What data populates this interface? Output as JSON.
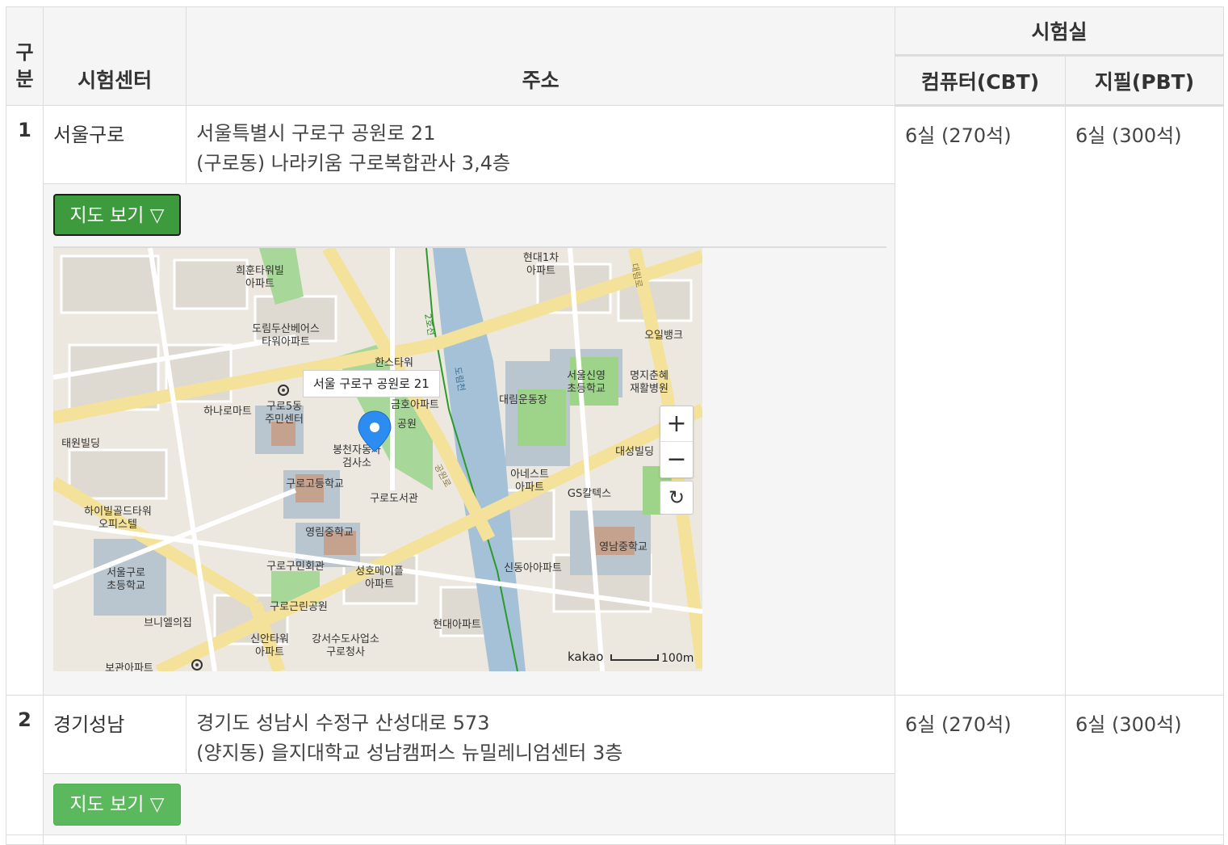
{
  "headers": {
    "gubun": "구분",
    "center": "시험센터",
    "address": "주소",
    "rooms": "시험실",
    "cbt": "컴퓨터(CBT)",
    "pbt": "지필(PBT)"
  },
  "rows": [
    {
      "num": "1",
      "center": "서울구로",
      "address_line1": "서울특별시 구로구 공원로 21",
      "address_line2": "(구로동) 나라키움 구로복합관사 3,4층",
      "cbt": "6실 (270석)",
      "pbt": "6실 (300석)",
      "map_button": "지도 보기 ▽"
    },
    {
      "num": "2",
      "center": "경기성남",
      "address_line1": "경기도 성남시 수정구 산성대로 573",
      "address_line2": "(양지동) 을지대학교 성남캠퍼스 뉴밀레니엄센터 3층",
      "cbt": "6실 (270석)",
      "pbt": "6실 (300석)",
      "map_button": "지도 보기 ▽"
    }
  ],
  "map": {
    "marker_label": "서울 구로구 공원로 21",
    "zoom_in": "+",
    "zoom_out": "−",
    "refresh": "↻",
    "brand": "kakao",
    "scale": "100m",
    "labels": {
      "l1": "희훈타워빌",
      "l2": "아파트",
      "l3": "도림두산베어스",
      "l4": "타워아파트",
      "l5": "한스타워",
      "l6": "구로5동",
      "l7": "주민센터",
      "l8": "하나로마트",
      "l9": "태원빌딩",
      "l10": "금호아파트",
      "l11": "봉천자동차",
      "l12": "검사소",
      "l13": "구로고등학교",
      "l14": "구로도서관",
      "l15": "영림중학교",
      "l16": "하이빌골드타워",
      "l17": "오피스텔",
      "l18": "서울구로",
      "l19": "초등학교",
      "l20": "구로구민회관",
      "l21": "성호메이플",
      "l22": "아파트",
      "l23": "구로근린공원",
      "l24": "브니엘의집",
      "l25": "신안타워",
      "l26": "아파트",
      "l27": "강서수도사업소",
      "l28": "구로청사",
      "l29": "현대아파트",
      "l30": "현대1차",
      "l31": "아파트",
      "l32": "오일뱅크",
      "l33": "서울신영",
      "l34": "초등학교",
      "l35": "명지춘혜",
      "l36": "재활병원",
      "l37": "대림운동장",
      "l38": "대성빌딩",
      "l39": "아네스트",
      "l40": "아파트",
      "l41": "GS칼텍스",
      "l42": "영남중학교",
      "l43": "신동아아파트",
      "l44": "도림천",
      "l45": "2호선",
      "l46": "공원로",
      "l47": "대림로",
      "l48": "보관아파트",
      "l49": "공원"
    }
  }
}
